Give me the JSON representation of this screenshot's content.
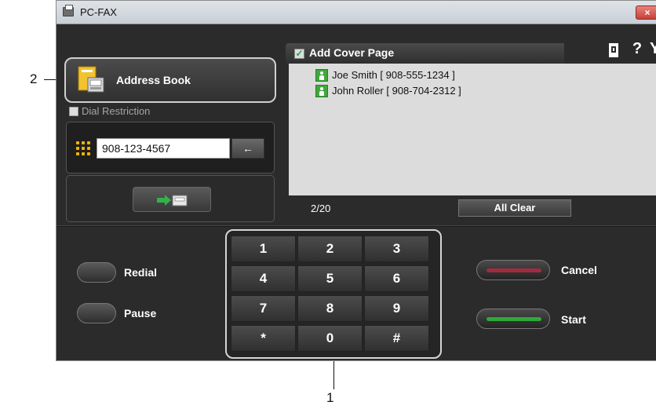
{
  "window": {
    "title": "PC-FAX",
    "close_label": "×"
  },
  "address_book": {
    "label": "Address Book"
  },
  "dial_restriction": {
    "label": "Dial Restriction"
  },
  "fax_number": {
    "value": "908-123-4567",
    "backspace_label": "←"
  },
  "cover_page": {
    "label": "Add Cover Page",
    "check": "✓"
  },
  "toolbar": {
    "help": "?",
    "settings": "Y!"
  },
  "recipients": [
    {
      "text": "Joe Smith [ 908-555-1234 ]"
    },
    {
      "text": "John Roller [ 908-704-2312 ]"
    }
  ],
  "list_footer": {
    "count": "2/20",
    "all_clear": "All Clear"
  },
  "controls": {
    "redial": "Redial",
    "pause": "Pause",
    "cancel": "Cancel",
    "start": "Start"
  },
  "keypad": {
    "keys": [
      "1",
      "2",
      "3",
      "4",
      "5",
      "6",
      "7",
      "8",
      "9",
      "*",
      "0",
      "#"
    ]
  },
  "callouts": {
    "address_book": "2",
    "keypad": "1"
  },
  "colors": {
    "cancel_accent": "#a32a3e",
    "start_accent": "#2ea83a",
    "keypad_icon": "#f5b400"
  }
}
